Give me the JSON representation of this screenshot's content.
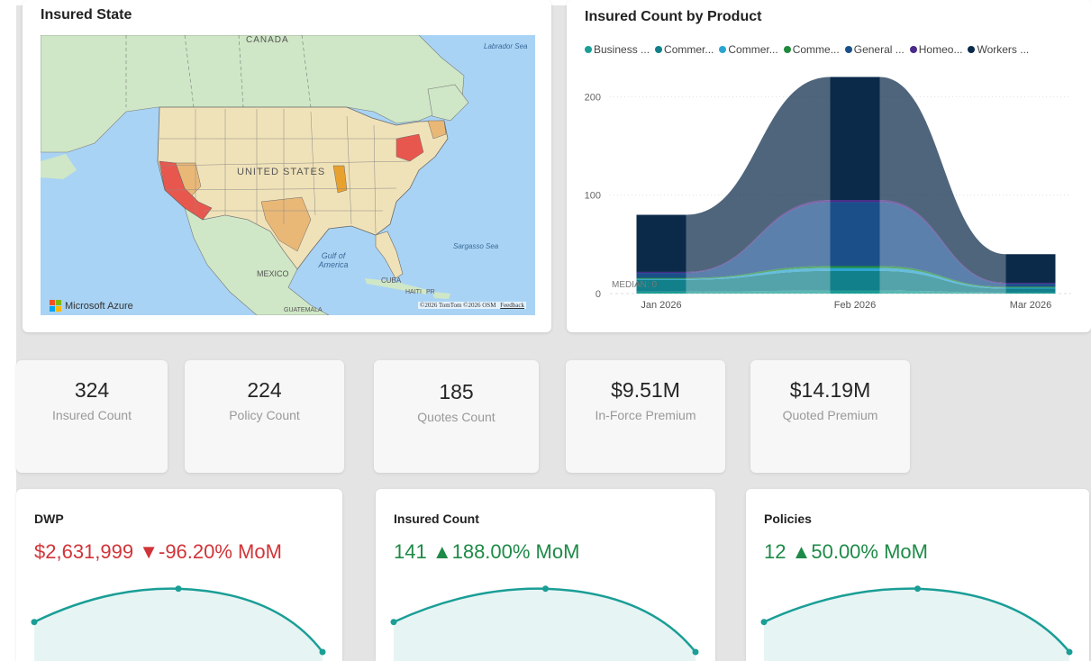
{
  "map": {
    "title": "Insured State",
    "labels": {
      "canada": "CANADA",
      "united_states": "UNITED STATES",
      "mexico": "MEXICO",
      "gulf": "Gulf of America",
      "labrador": "Labrador Sea",
      "sargasso": "Sargasso Sea",
      "cuba": "CUBA",
      "haiti": "HAITI",
      "pr": "PR",
      "guatemala": "GUATEMALA"
    },
    "brand": "Microsoft Azure",
    "copyright": "©2026 TomTom ©2026 OSM",
    "feedback": "Feedback",
    "colors": {
      "water": "#a9d3f4",
      "land": "#cfe7c6",
      "low": "#f0e2b8",
      "mid": "#e9b877",
      "high": "#e8574e"
    }
  },
  "area_chart": {
    "title": "Insured Count by Product",
    "legend": [
      {
        "label": "Business ...",
        "color": "#1a9e96"
      },
      {
        "label": "Commer...",
        "color": "#12808a"
      },
      {
        "label": "Commer...",
        "color": "#2aa4d1"
      },
      {
        "label": "Comme...",
        "color": "#1e8a3c"
      },
      {
        "label": "General ...",
        "color": "#1b4f8a"
      },
      {
        "label": "Homeo...",
        "color": "#4b2a8a"
      },
      {
        "label": "Workers ...",
        "color": "#0b2a4a"
      }
    ],
    "median_label": "MEDIAN: 0"
  },
  "chart_data": {
    "type": "area",
    "x": [
      "Jan 2026",
      "Feb 2026",
      "Mar 2026"
    ],
    "yticks": [
      0,
      100,
      200
    ],
    "ylim": [
      0,
      225
    ],
    "series": [
      {
        "name": "Business ...",
        "values": [
          2,
          3,
          1
        ]
      },
      {
        "name": "Commer...",
        "values": [
          12,
          20,
          4
        ]
      },
      {
        "name": "Commer...",
        "values": [
          1,
          3,
          1
        ]
      },
      {
        "name": "Comme...",
        "values": [
          1,
          2,
          1
        ]
      },
      {
        "name": "General ...",
        "values": [
          5,
          65,
          3
        ]
      },
      {
        "name": "Homeo...",
        "values": [
          1,
          2,
          1
        ]
      },
      {
        "name": "Workers ...",
        "values": [
          58,
          125,
          29
        ]
      }
    ],
    "colors": [
      "#1a9e96",
      "#12808a",
      "#2aa4d1",
      "#1e8a3c",
      "#1b4f8a",
      "#4b2a8a",
      "#0b2a4a"
    ],
    "legend_position": "top-left",
    "grid": true
  },
  "kpis": [
    {
      "value": "324",
      "label": "Insured Count"
    },
    {
      "value": "224",
      "label": "Policy Count"
    },
    {
      "value": "185",
      "label": "Quotes Count"
    },
    {
      "value": "$9.51M",
      "label": "In-Force Premium"
    },
    {
      "value": "$14.19M",
      "label": "Quoted Premium"
    }
  ],
  "sparks": [
    {
      "title": "DWP",
      "value": "$2,631,999 ▼-96.20% MoM",
      "color": "#d13438",
      "trend": [
        0.45,
        0.95,
        0.0
      ]
    },
    {
      "title": "Insured Count",
      "value": "141 ▲188.00% MoM",
      "color": "#1e8a47",
      "trend": [
        0.45,
        0.95,
        0.0
      ]
    },
    {
      "title": "Policies",
      "value": "12 ▲50.00% MoM",
      "color": "#1e8a47",
      "trend": [
        0.45,
        0.95,
        0.0
      ]
    }
  ],
  "spark_style": {
    "line": "#1a9e96",
    "fill": "#e7f4f4"
  }
}
